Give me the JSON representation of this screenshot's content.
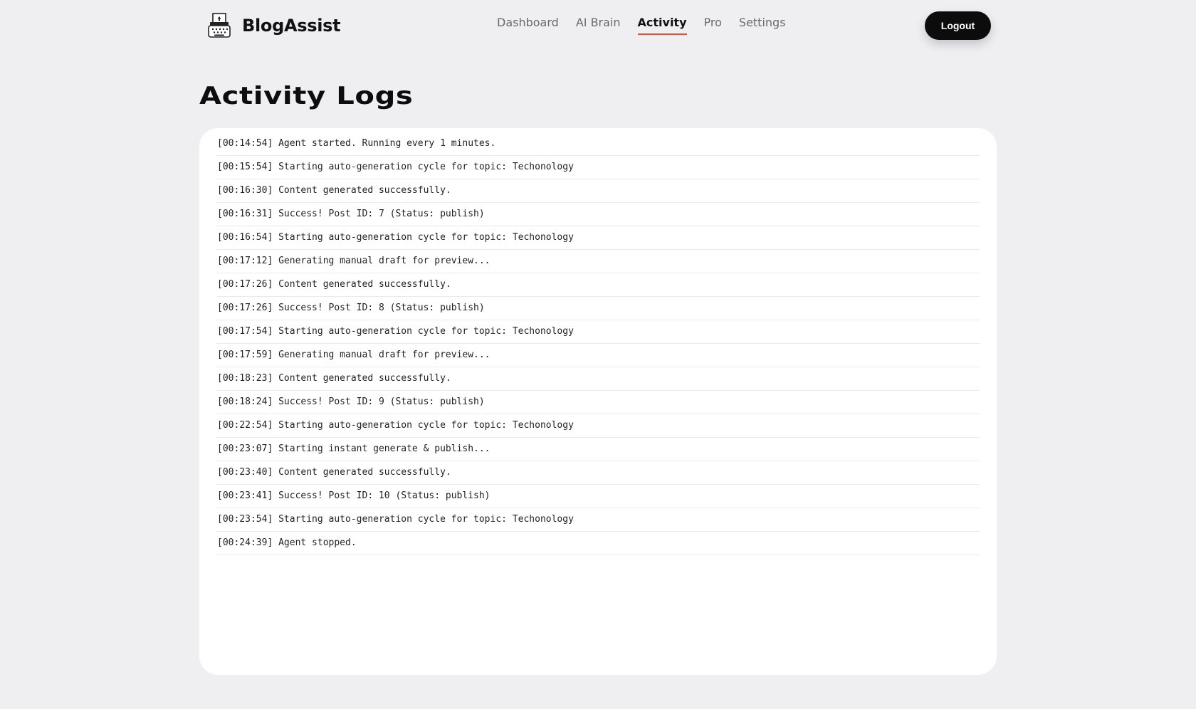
{
  "brand": {
    "name": "BlogAssist",
    "logo_icon": "typewriter-icon"
  },
  "nav": {
    "items": [
      {
        "label": "Dashboard",
        "active": false
      },
      {
        "label": "AI Brain",
        "active": false
      },
      {
        "label": "Activity",
        "active": true
      },
      {
        "label": "Pro",
        "active": false
      },
      {
        "label": "Settings",
        "active": false
      }
    ],
    "active_underline_color": "#e2502e"
  },
  "logout_label": "Logout",
  "page": {
    "title": "Activity Logs"
  },
  "logs": [
    "[00:14:54] Agent started. Running every 1 minutes.",
    "[00:15:54] Starting auto-generation cycle for topic: Techonology",
    "[00:16:30] Content generated successfully.",
    "[00:16:31] Success! Post ID: 7 (Status: publish)",
    "[00:16:54] Starting auto-generation cycle for topic: Techonology",
    "[00:17:12] Generating manual draft for preview...",
    "[00:17:26] Content generated successfully.",
    "[00:17:26] Success! Post ID: 8 (Status: publish)",
    "[00:17:54] Starting auto-generation cycle for topic: Techonology",
    "[00:17:59] Generating manual draft for preview...",
    "[00:18:23] Content generated successfully.",
    "[00:18:24] Success! Post ID: 9 (Status: publish)",
    "[00:22:54] Starting auto-generation cycle for topic: Techonology",
    "[00:23:07] Starting instant generate & publish...",
    "[00:23:40] Content generated successfully.",
    "[00:23:41] Success! Post ID: 10 (Status: publish)",
    "[00:23:54] Starting auto-generation cycle for topic: Techonology",
    "[00:24:39] Agent stopped."
  ]
}
